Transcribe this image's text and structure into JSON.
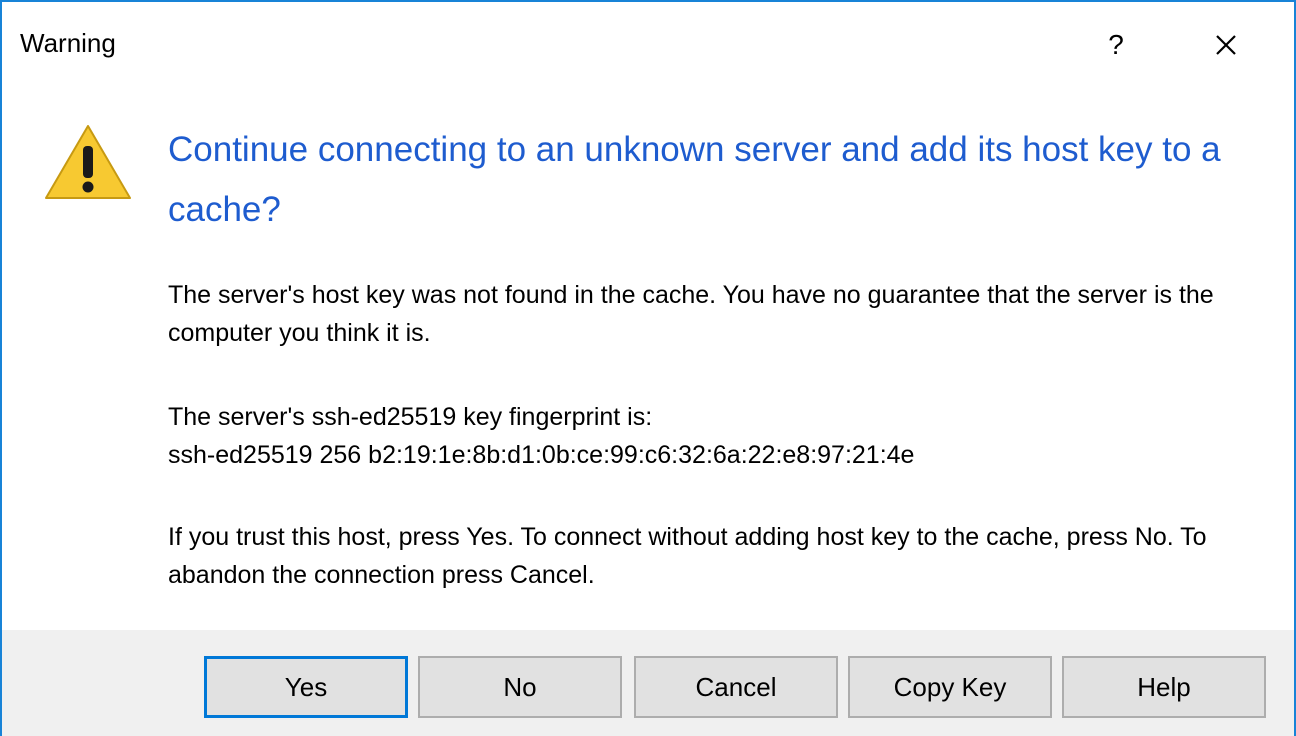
{
  "window": {
    "title": "Warning",
    "help_glyph": "?",
    "close_icon": "close-icon"
  },
  "message": {
    "icon": "warning-icon",
    "heading": "Continue connecting to an unknown server and add its host key to a cache?",
    "paragraph1": "The server's host key was not found in the cache. You have no guarantee that the server is the computer you think it is.",
    "fingerprint_label": "The server's ssh-ed25519 key fingerprint is:",
    "fingerprint_value": "ssh-ed25519 256 b2:19:1e:8b:d1:0b:ce:99:c6:32:6a:22:e8:97:21:4e",
    "paragraph3": "If you trust this host, press Yes. To connect without adding host key to the cache, press No. To abandon the connection press Cancel."
  },
  "buttons": {
    "yes": "Yes",
    "no": "No",
    "cancel": "Cancel",
    "copy_key": "Copy Key",
    "help": "Help"
  },
  "colors": {
    "border_accent": "#1883d7",
    "heading": "#1e5ccf",
    "warning_fill": "#f7c931",
    "button_face": "#e1e1e1",
    "footer": "#f0f0f0"
  }
}
